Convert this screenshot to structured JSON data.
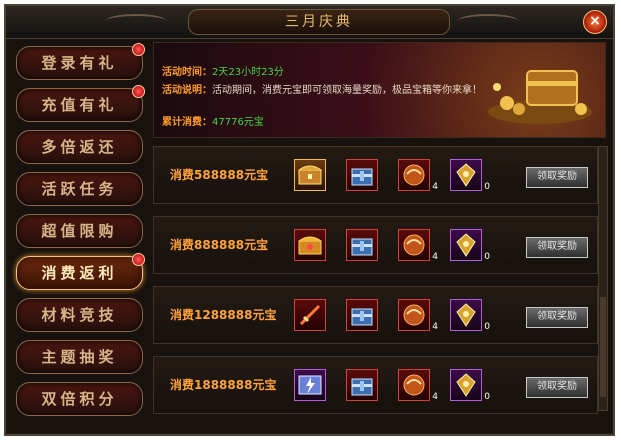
{
  "window": {
    "title": "三月庆典",
    "close_glyph": "×"
  },
  "sidebar": {
    "items": [
      {
        "label": "登录有礼",
        "badge": true
      },
      {
        "label": "充值有礼",
        "badge": true
      },
      {
        "label": "多倍返还",
        "badge": false
      },
      {
        "label": "活跃任务",
        "badge": false
      },
      {
        "label": "超值限购",
        "badge": false
      },
      {
        "label": "消费返利",
        "badge": true,
        "active": true
      },
      {
        "label": "材料竞技",
        "badge": false
      },
      {
        "label": "主题抽奖",
        "badge": false
      },
      {
        "label": "双倍积分",
        "badge": false
      }
    ]
  },
  "banner": {
    "time_label": "活动时间：",
    "time_value": "2天23小时23分",
    "desc_label": "活动说明：",
    "desc_value": "活动期间，消费元宝即可领取海量奖励，极品宝箱等你来拿！",
    "spent_label": "累计消费：",
    "spent_value": "47776元宝"
  },
  "rewards": [
    {
      "label": "消费588888元宝",
      "claim": "领取奖励",
      "items": [
        {
          "icon": "golden-chest-icon",
          "quality": "orange",
          "count": ""
        },
        {
          "icon": "blue-chest-icon",
          "quality": "red",
          "count": ""
        },
        {
          "icon": "orb-icon",
          "quality": "red",
          "count": "4"
        },
        {
          "icon": "gold-token-icon",
          "quality": "purple",
          "count": "0"
        }
      ]
    },
    {
      "label": "消费888888元宝",
      "claim": "领取奖励",
      "items": [
        {
          "icon": "gem-chest-icon",
          "quality": "red",
          "count": ""
        },
        {
          "icon": "blue-chest-icon",
          "quality": "red",
          "count": ""
        },
        {
          "icon": "orb-icon",
          "quality": "red",
          "count": "4"
        },
        {
          "icon": "gold-token-icon",
          "quality": "purple",
          "count": "0"
        }
      ]
    },
    {
      "label": "消费1288888元宝",
      "claim": "领取奖励",
      "items": [
        {
          "icon": "sword-icon",
          "quality": "red",
          "count": ""
        },
        {
          "icon": "blue-chest-icon",
          "quality": "red",
          "count": ""
        },
        {
          "icon": "orb-icon",
          "quality": "red",
          "count": "4"
        },
        {
          "icon": "gold-token-icon",
          "quality": "purple",
          "count": "0"
        }
      ]
    },
    {
      "label": "消费1888888元宝",
      "claim": "领取奖励",
      "items": [
        {
          "icon": "lightning-scroll-icon",
          "quality": "purple",
          "count": ""
        },
        {
          "icon": "blue-chest-icon",
          "quality": "red",
          "count": ""
        },
        {
          "icon": "orb-icon",
          "quality": "red",
          "count": "4"
        },
        {
          "icon": "gold-token-icon",
          "quality": "purple",
          "count": "0"
        }
      ]
    }
  ],
  "colors": {
    "accent_orange": "#ffa23c",
    "value_green": "#47d44a",
    "title_gold": "#e7b96a"
  }
}
